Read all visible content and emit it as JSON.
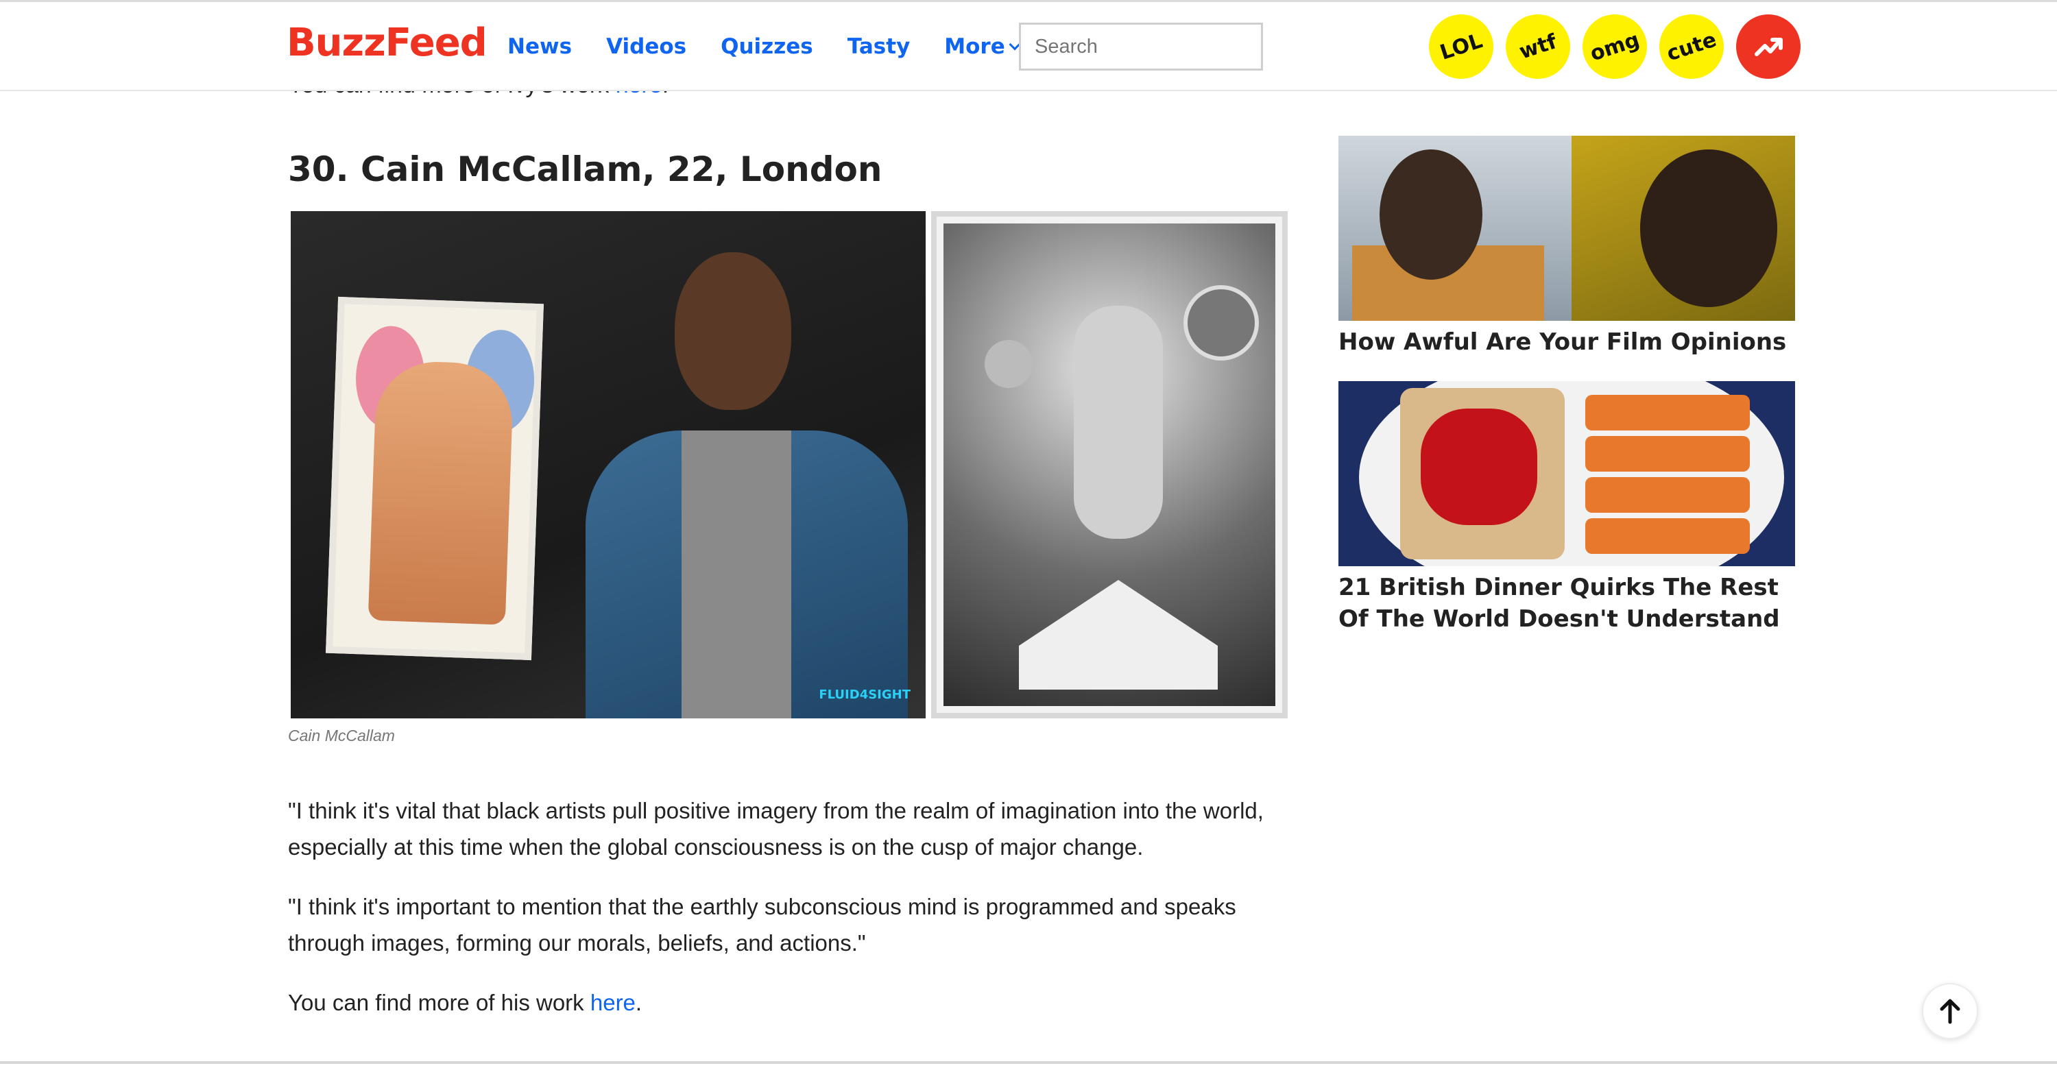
{
  "header": {
    "logo": "BuzzFeed",
    "nav": [
      "News",
      "Videos",
      "Quizzes",
      "Tasty",
      "More"
    ],
    "search_placeholder": "Search",
    "badges": [
      "LOL",
      "wtf",
      "omg",
      "cute"
    ],
    "trending_icon": "trending-arrow-icon"
  },
  "article": {
    "previous_line": "You can find more of Ivy's work",
    "previous_link": "here",
    "headline": "30. Cain McCallam, 22, London",
    "photo_watermark": "FLUID4SIGHT",
    "caption": "Cain McCallam",
    "paragraphs": [
      "\"I think it's vital that black artists pull positive imagery from the realm of imagination into the world, especially at this time when the global consciousness is on the cusp of major change.",
      "\"I think it's important to mention that the earthly subconscious mind is programmed and speaks through images, forming our morals, beliefs, and actions.\""
    ],
    "more_text": "You can find more of his work",
    "more_link": "here",
    "more_suffix": "."
  },
  "sidebar": {
    "cards": [
      {
        "title": "How Awful Are Your Film Opinions"
      },
      {
        "title": "21 British Dinner Quirks The Rest Of The World Doesn't Understand"
      }
    ]
  },
  "colors": {
    "brand": "#ee3322",
    "link": "#0f65ef",
    "badge": "#fff200"
  },
  "icons": {
    "back_to_top": "arrow-up-icon",
    "more": "chevron-down-icon"
  }
}
